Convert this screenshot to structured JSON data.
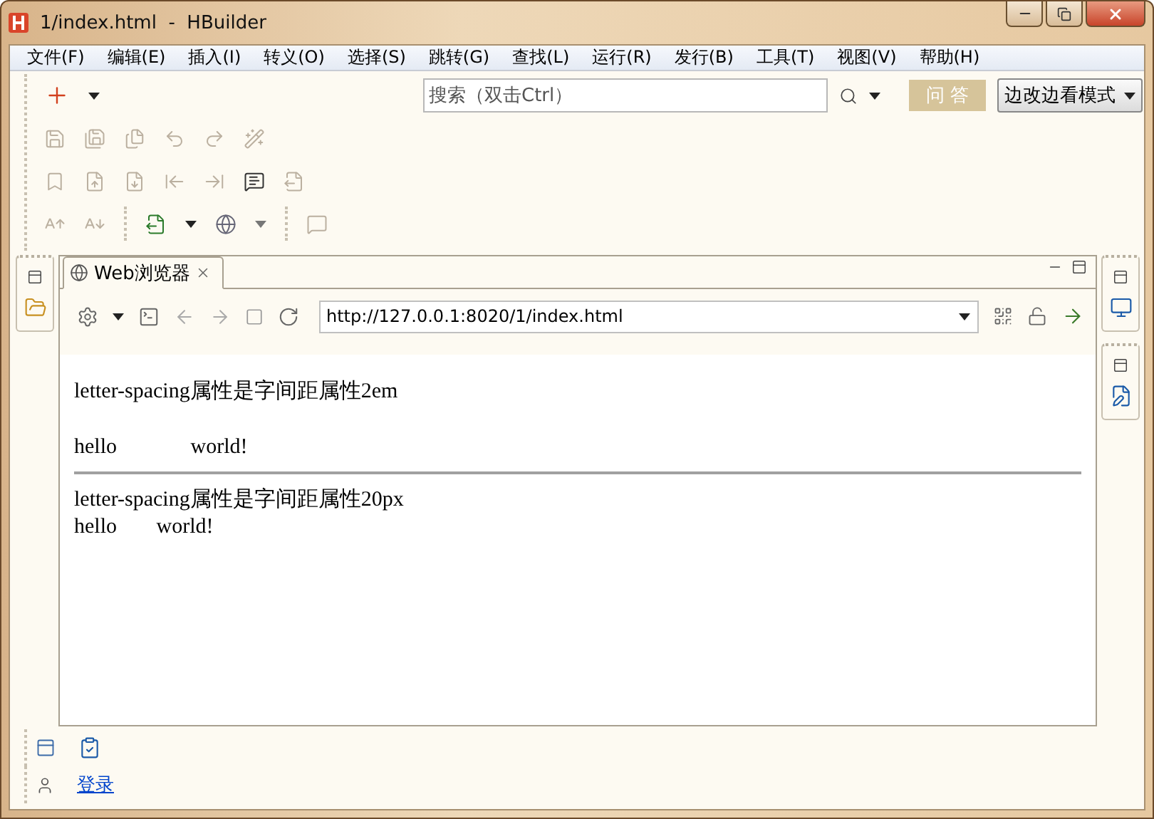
{
  "window": {
    "title": "1/index.html  -  HBuilder"
  },
  "menu": [
    "文件(F)",
    "编辑(E)",
    "插入(I)",
    "转义(O)",
    "选择(S)",
    "跳转(G)",
    "查找(L)",
    "运行(R)",
    "发行(B)",
    "工具(T)",
    "视图(V)",
    "帮助(H)"
  ],
  "toolbar": {
    "search": {
      "placeholder": "搜索（双击Ctrl）"
    },
    "qa_button": "问 答",
    "mode_select": "边改边看模式"
  },
  "browser": {
    "tab": {
      "label": "Web浏览器",
      "selected": true
    },
    "url": "http://127.0.0.1:8020/1/index.html",
    "content": [
      {
        "kind": "line",
        "text": "letter-spacing属性是字间距属性2em"
      },
      {
        "kind": "wide",
        "text": "hello world!"
      },
      {
        "kind": "rule"
      },
      {
        "kind": "tight",
        "text": "letter-spacing属性是字间距属性20px"
      },
      {
        "kind": "narrow",
        "text": "hello world!"
      }
    ]
  },
  "footer": {
    "login_link": "登录"
  }
}
